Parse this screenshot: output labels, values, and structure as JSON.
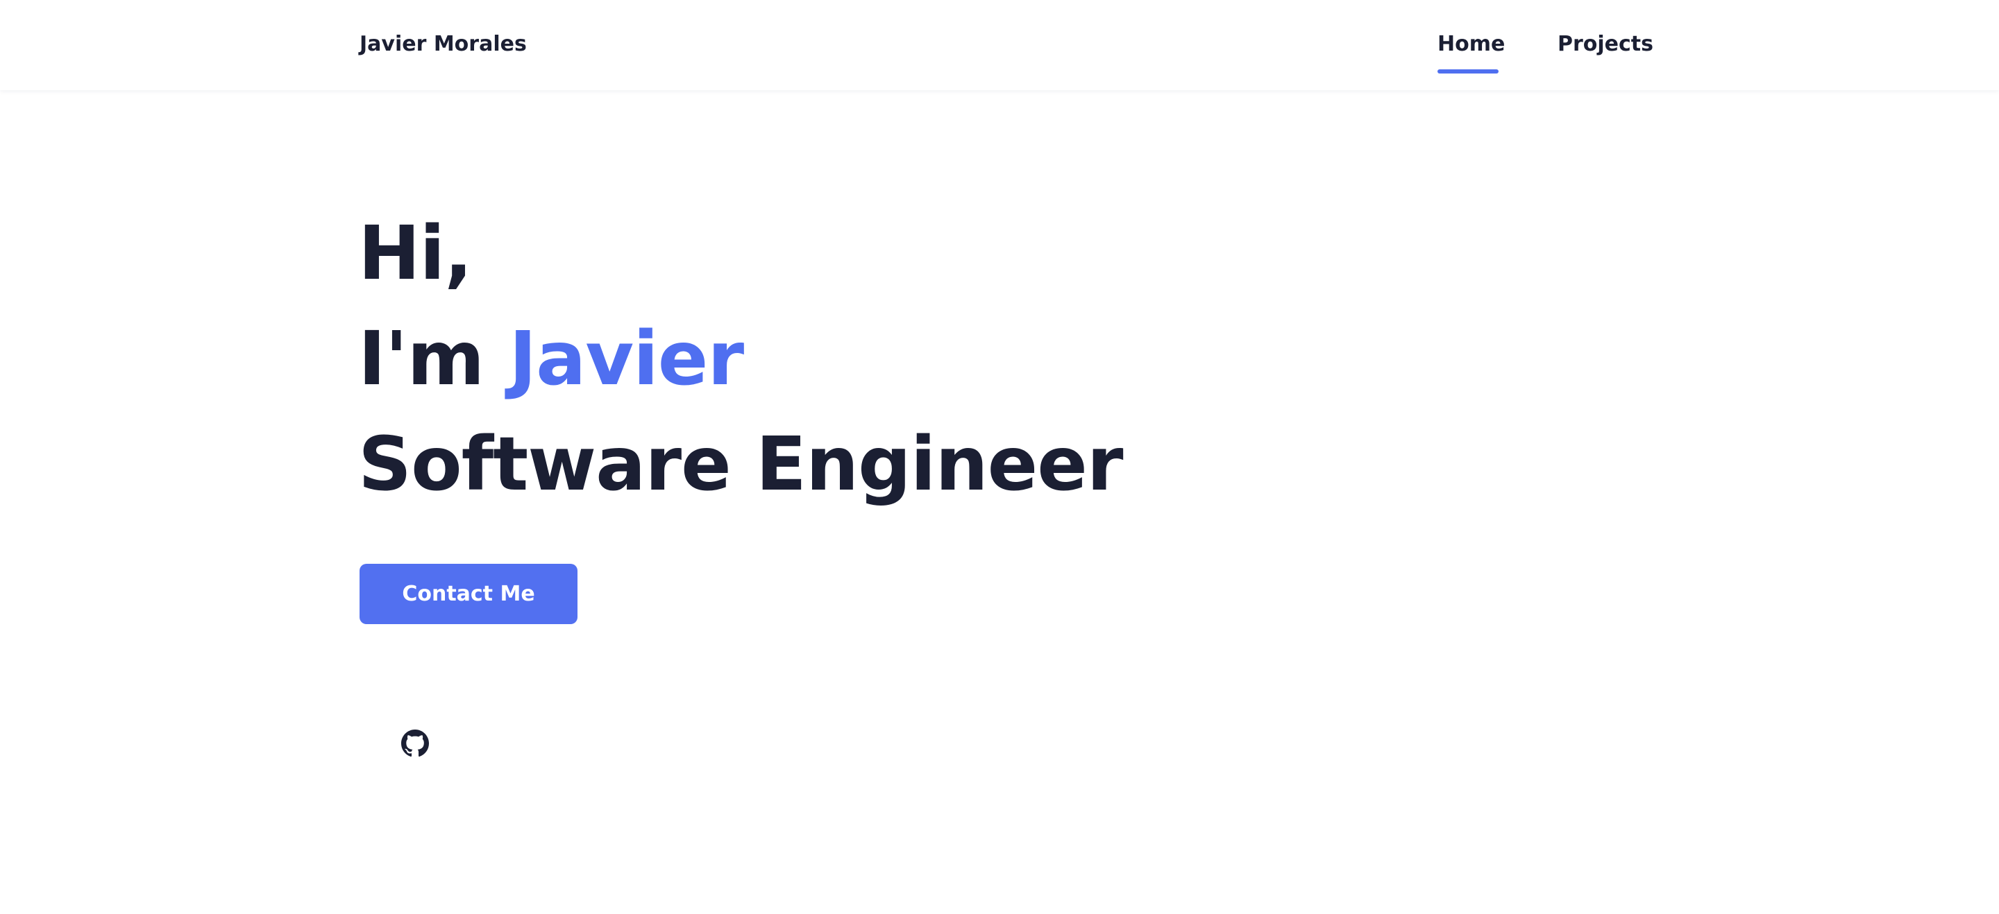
{
  "header": {
    "logo_text": "Javier Morales",
    "nav": [
      {
        "label": "Home",
        "active": true
      },
      {
        "label": "Projects",
        "active": false
      }
    ]
  },
  "hero": {
    "line1": "Hi,",
    "line2_prefix": "I'm ",
    "line2_name": "Javier",
    "line3": "Software Engineer",
    "cta_label": "Contact Me"
  },
  "social": {
    "icons": [
      "github-icon"
    ]
  },
  "colors": {
    "accent": "#4f6ff0",
    "text": "#1b1f33",
    "background": "#ffffff"
  }
}
